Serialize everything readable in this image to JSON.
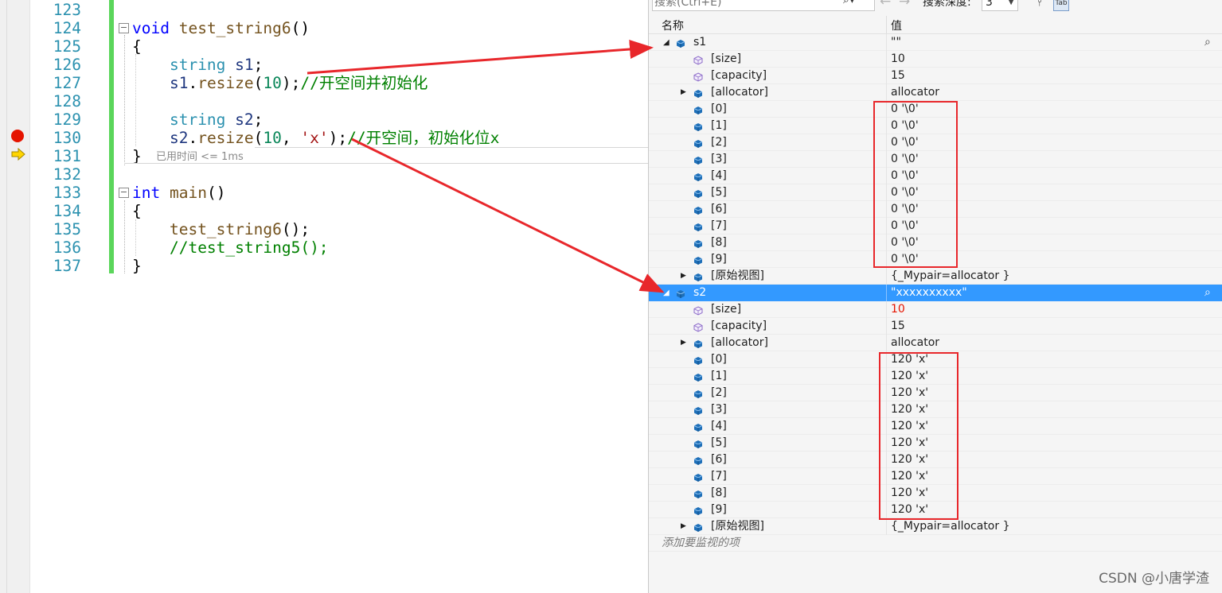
{
  "editor": {
    "lines": [
      {
        "num": "123",
        "tokens": []
      },
      {
        "num": "124",
        "fold": "−",
        "tokens": [
          {
            "t": "void",
            "c": "kw"
          },
          {
            "t": " "
          },
          {
            "t": "test_string6",
            "c": "fn"
          },
          {
            "t": "()"
          }
        ]
      },
      {
        "num": "125",
        "tokens": [
          {
            "t": "{"
          }
        ]
      },
      {
        "num": "126",
        "tokens": [
          {
            "t": "    "
          },
          {
            "t": "string",
            "c": "typ"
          },
          {
            "t": " "
          },
          {
            "t": "s1",
            "c": "var"
          },
          {
            "t": ";"
          }
        ]
      },
      {
        "num": "127",
        "tokens": [
          {
            "t": "    "
          },
          {
            "t": "s1",
            "c": "var"
          },
          {
            "t": "."
          },
          {
            "t": "resize",
            "c": "fn"
          },
          {
            "t": "("
          },
          {
            "t": "10",
            "c": "num"
          },
          {
            "t": ");"
          },
          {
            "t": "//开空间并初始化",
            "c": "cm"
          }
        ]
      },
      {
        "num": "128",
        "tokens": []
      },
      {
        "num": "129",
        "tokens": [
          {
            "t": "    "
          },
          {
            "t": "string",
            "c": "typ"
          },
          {
            "t": " "
          },
          {
            "t": "s2",
            "c": "var"
          },
          {
            "t": ";"
          }
        ]
      },
      {
        "num": "130",
        "tokens": [
          {
            "t": "    "
          },
          {
            "t": "s2",
            "c": "var"
          },
          {
            "t": "."
          },
          {
            "t": "resize",
            "c": "fn"
          },
          {
            "t": "("
          },
          {
            "t": "10",
            "c": "num"
          },
          {
            "t": ", "
          },
          {
            "t": "'x'",
            "c": "str"
          },
          {
            "t": ");"
          },
          {
            "t": "//开空间，初始化位x",
            "c": "cm"
          }
        ]
      },
      {
        "num": "131",
        "tokens": [
          {
            "t": "}"
          }
        ]
      },
      {
        "num": "132",
        "tokens": []
      },
      {
        "num": "133",
        "fold": "−",
        "tokens": [
          {
            "t": "int",
            "c": "kw"
          },
          {
            "t": " "
          },
          {
            "t": "main",
            "c": "fn"
          },
          {
            "t": "()"
          }
        ]
      },
      {
        "num": "134",
        "tokens": [
          {
            "t": "{"
          }
        ]
      },
      {
        "num": "135",
        "tokens": [
          {
            "t": "    "
          },
          {
            "t": "test_string6",
            "c": "fn"
          },
          {
            "t": "();"
          }
        ]
      },
      {
        "num": "136",
        "tokens": [
          {
            "t": "    "
          },
          {
            "t": "//test_string5();",
            "c": "cm"
          }
        ]
      },
      {
        "num": "137",
        "tokens": [
          {
            "t": "}"
          }
        ]
      }
    ],
    "elapsed": "已用时间 <= 1ms",
    "breakpoint_line": "130",
    "current_line": "131"
  },
  "watch": {
    "search_placeholder": "搜索(Ctrl+E)",
    "depth_label": "搜索深度:",
    "depth_value": "3",
    "columns": {
      "name": "名称",
      "value": "值"
    },
    "rows": [
      {
        "name": "s1",
        "value": "\"\"",
        "level": 0,
        "expander": "expanded",
        "icon": "variable",
        "magnifier": true
      },
      {
        "name": "[size]",
        "value": "10",
        "level": 1,
        "icon": "property"
      },
      {
        "name": "[capacity]",
        "value": "15",
        "level": 1,
        "icon": "property"
      },
      {
        "name": "[allocator]",
        "value": "allocator",
        "level": 1,
        "expander": "collapsed",
        "icon": "variable"
      },
      {
        "name": "[0]",
        "value": "0 '\\0'",
        "level": 1,
        "icon": "variable"
      },
      {
        "name": "[1]",
        "value": "0 '\\0'",
        "level": 1,
        "icon": "variable"
      },
      {
        "name": "[2]",
        "value": "0 '\\0'",
        "level": 1,
        "icon": "variable"
      },
      {
        "name": "[3]",
        "value": "0 '\\0'",
        "level": 1,
        "icon": "variable"
      },
      {
        "name": "[4]",
        "value": "0 '\\0'",
        "level": 1,
        "icon": "variable"
      },
      {
        "name": "[5]",
        "value": "0 '\\0'",
        "level": 1,
        "icon": "variable"
      },
      {
        "name": "[6]",
        "value": "0 '\\0'",
        "level": 1,
        "icon": "variable"
      },
      {
        "name": "[7]",
        "value": "0 '\\0'",
        "level": 1,
        "icon": "variable"
      },
      {
        "name": "[8]",
        "value": "0 '\\0'",
        "level": 1,
        "icon": "variable"
      },
      {
        "name": "[9]",
        "value": "0 '\\0'",
        "level": 1,
        "icon": "variable"
      },
      {
        "name": "[原始视图]",
        "value": "{_Mypair=allocator }",
        "level": 1,
        "expander": "collapsed",
        "icon": "variable"
      },
      {
        "name": "s2",
        "value": "\"xxxxxxxxxx\"",
        "level": 0,
        "expander": "expanded",
        "icon": "variable",
        "magnifier": true,
        "selected": true
      },
      {
        "name": "[size]",
        "value": "10",
        "level": 1,
        "icon": "property",
        "changed": true
      },
      {
        "name": "[capacity]",
        "value": "15",
        "level": 1,
        "icon": "property"
      },
      {
        "name": "[allocator]",
        "value": "allocator",
        "level": 1,
        "expander": "collapsed",
        "icon": "variable"
      },
      {
        "name": "[0]",
        "value": "120 'x'",
        "level": 1,
        "icon": "variable"
      },
      {
        "name": "[1]",
        "value": "120 'x'",
        "level": 1,
        "icon": "variable"
      },
      {
        "name": "[2]",
        "value": "120 'x'",
        "level": 1,
        "icon": "variable"
      },
      {
        "name": "[3]",
        "value": "120 'x'",
        "level": 1,
        "icon": "variable"
      },
      {
        "name": "[4]",
        "value": "120 'x'",
        "level": 1,
        "icon": "variable"
      },
      {
        "name": "[5]",
        "value": "120 'x'",
        "level": 1,
        "icon": "variable"
      },
      {
        "name": "[6]",
        "value": "120 'x'",
        "level": 1,
        "icon": "variable"
      },
      {
        "name": "[7]",
        "value": "120 'x'",
        "level": 1,
        "icon": "variable"
      },
      {
        "name": "[8]",
        "value": "120 'x'",
        "level": 1,
        "icon": "variable"
      },
      {
        "name": "[9]",
        "value": "120 'x'",
        "level": 1,
        "icon": "variable"
      },
      {
        "name": "[原始视图]",
        "value": "{_Mypair=allocator }",
        "level": 1,
        "expander": "collapsed",
        "icon": "variable"
      },
      {
        "name": "添加要监视的项",
        "value": "",
        "level": 0,
        "add": true
      }
    ]
  },
  "colors": {
    "accent": "#3399ff",
    "annotation": "#e8272b",
    "breakpoint": "#e51400",
    "changed_value": "#e51400",
    "change_bar": "#5bd65b"
  },
  "watermark": "CSDN @小唐学渣"
}
